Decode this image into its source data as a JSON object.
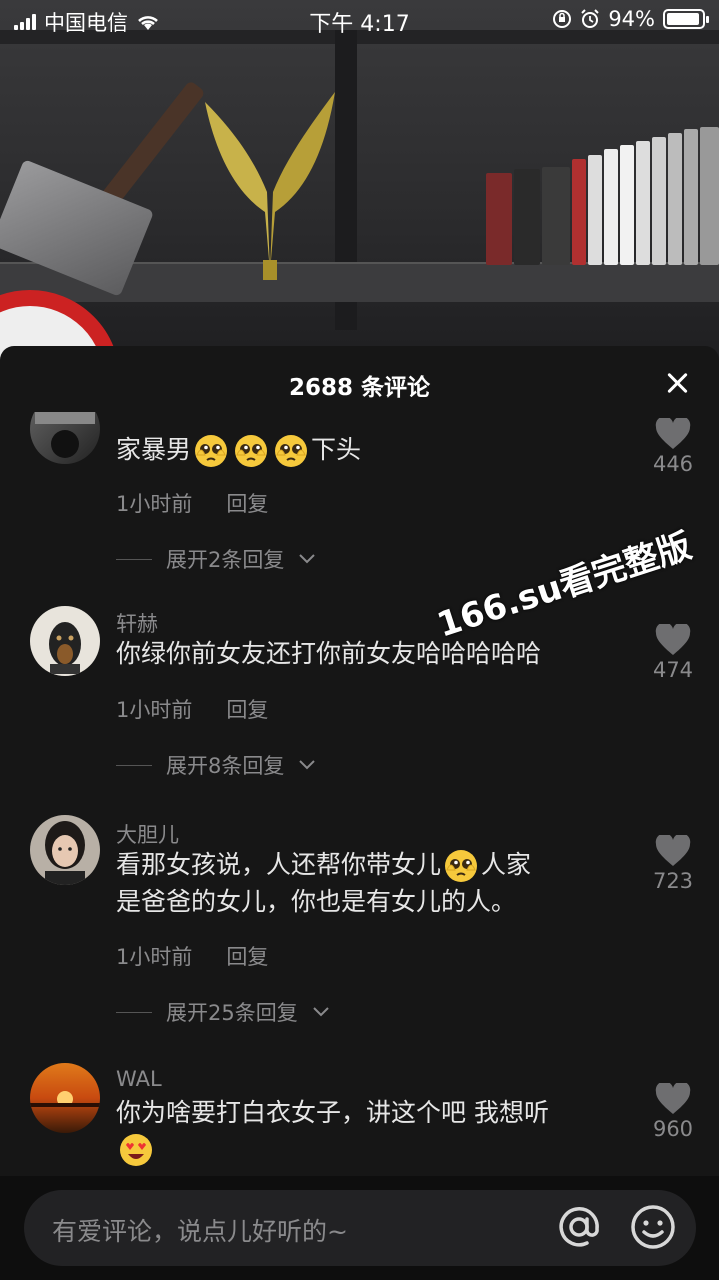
{
  "status_bar": {
    "carrier": "中国电信",
    "time": "下午 4:17",
    "battery_percent": "94%",
    "battery_level": 0.94,
    "icons": [
      "signal-icon",
      "wifi-icon",
      "orientation-lock-icon",
      "alarm-icon",
      "battery-icon"
    ]
  },
  "sheet": {
    "title": "2688 条评论",
    "close_icon": "close-icon"
  },
  "comments": [
    {
      "username": "· ·",
      "text_parts": [
        "家暴男",
        "下头"
      ],
      "emoji_count": 3,
      "time": "1小时前",
      "reply_label": "回复",
      "expand_label": "展开2条回复",
      "likes": "446"
    },
    {
      "username": "轩赫",
      "text": "你绿你前女友还打你前女友哈哈哈哈哈",
      "time": "1小时前",
      "reply_label": "回复",
      "expand_label": "展开8条回复",
      "likes": "474"
    },
    {
      "username": "大胆儿",
      "text_line1_a": "看那女孩说，人还帮你带女儿",
      "text_line1_b": "人家",
      "text_line2": "是爸爸的女儿，你也是有女儿的人。",
      "time": "1小时前",
      "reply_label": "回复",
      "expand_label": "展开25条回复",
      "likes": "723"
    },
    {
      "username": "WAL",
      "text": "你为啥要打白衣女子，讲这个吧 我想听",
      "likes": "960"
    }
  ],
  "watermark": "166.su看完整版",
  "input_bar": {
    "placeholder": "有爱评论，说点儿好听的~",
    "icons": [
      "at-icon",
      "emoji-face-icon"
    ]
  },
  "colors": {
    "sheet_bg": "#161616",
    "text_primary": "#e6e6e6",
    "text_secondary": "#8a8a8c",
    "input_bg": "#222224"
  }
}
